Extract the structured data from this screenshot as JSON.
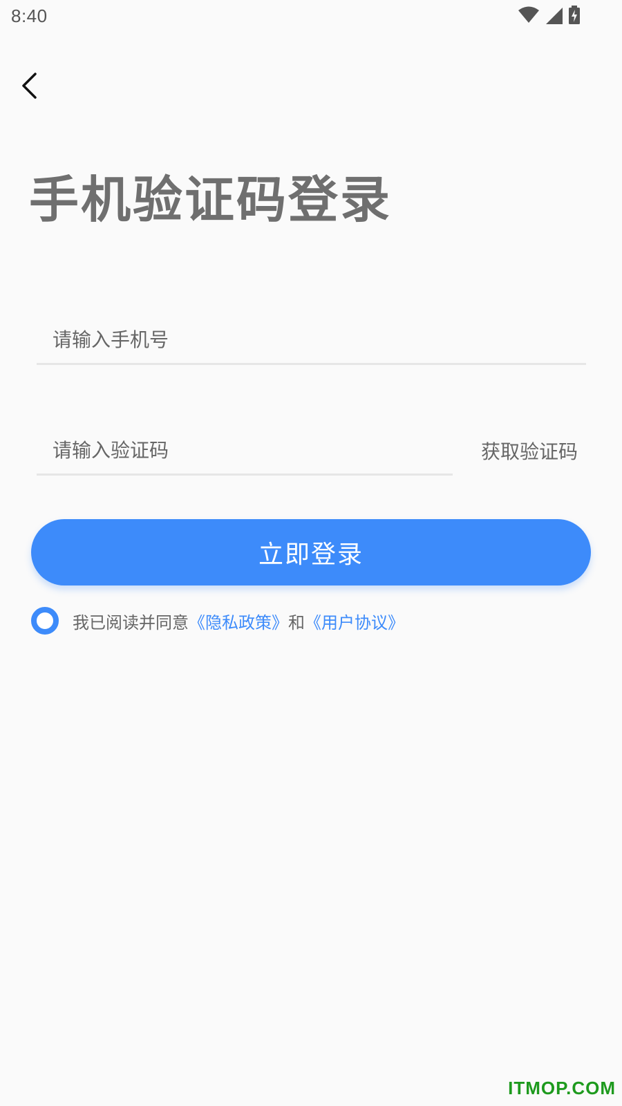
{
  "status_bar": {
    "time": "8:40",
    "icons": [
      "wifi-icon",
      "cellular-signal-icon",
      "battery-charging-icon"
    ]
  },
  "header": {
    "back_icon": "chevron-left-icon"
  },
  "page": {
    "title": "手机验证码登录"
  },
  "form": {
    "phone_placeholder": "请输入手机号",
    "phone_value": "",
    "code_placeholder": "请输入验证码",
    "code_value": "",
    "get_code_label": "获取验证码",
    "login_label": "立即登录"
  },
  "agreement": {
    "checked": false,
    "prefix": "我已阅读并同意",
    "privacy_link": "《隐私政策》",
    "conjunction": "和",
    "terms_link": "《用户协议》"
  },
  "watermark": "ITMOP.COM",
  "colors": {
    "accent": "#3d8bfa",
    "background": "#fafafa",
    "title": "#6f6f6f",
    "watermark": "#1e9a1e"
  }
}
